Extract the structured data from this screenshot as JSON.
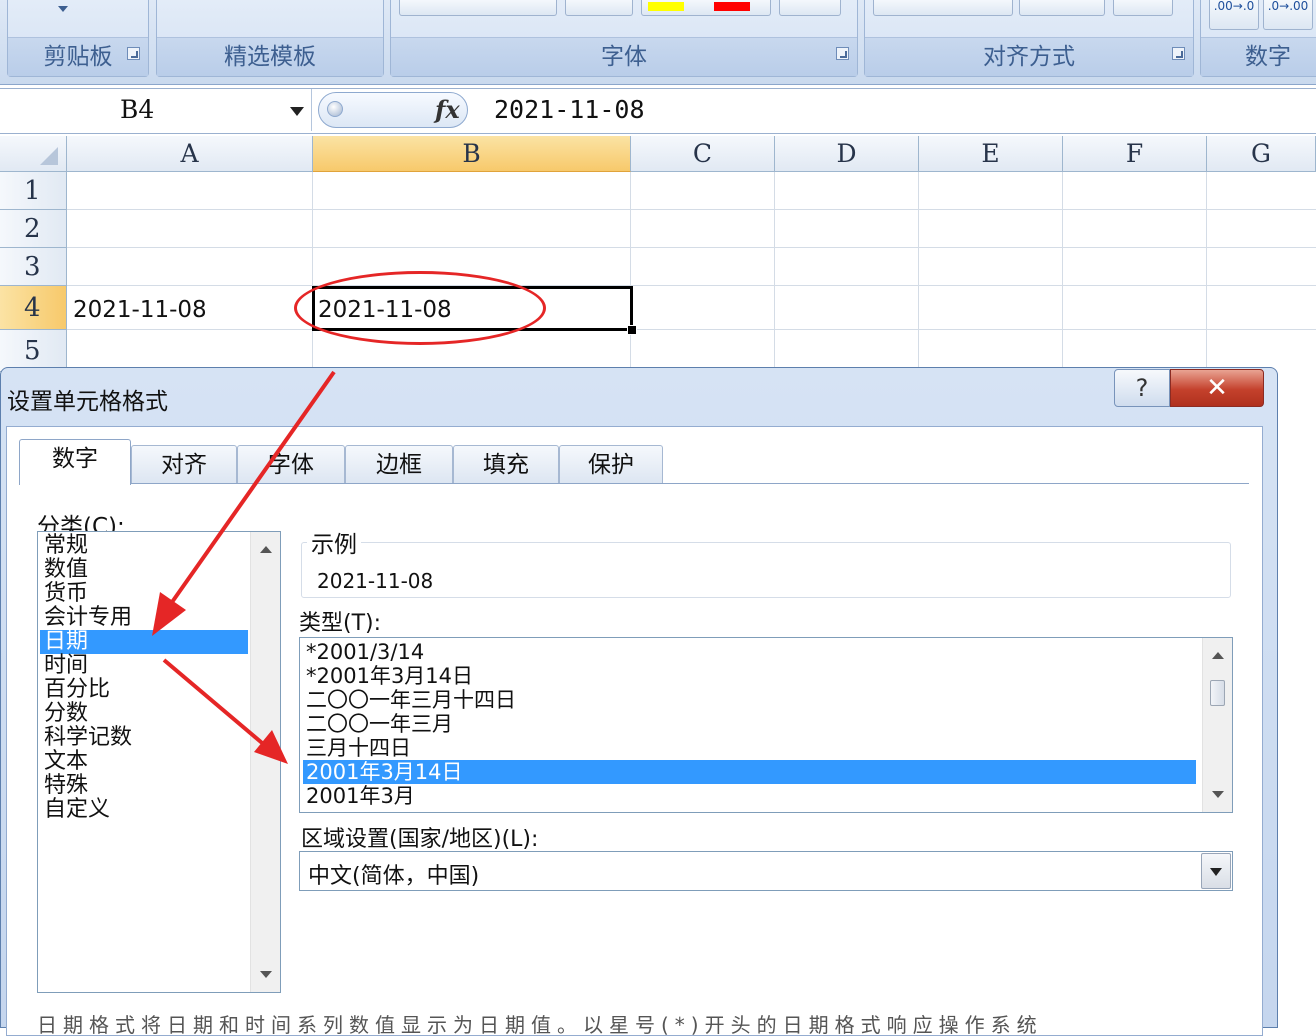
{
  "ribbon": {
    "groups": [
      "剪贴板",
      "精选模板",
      "字体",
      "对齐方式",
      "数字"
    ],
    "number_format_icons": [
      ".00→.0",
      ".0→.00"
    ]
  },
  "formula_bar": {
    "name_box": "B4",
    "fx_icon": "fx",
    "content": "2021-11-08"
  },
  "sheet": {
    "columns": [
      "A",
      "B",
      "C",
      "D",
      "E",
      "F",
      "G"
    ],
    "rows": [
      "1",
      "2",
      "3",
      "4",
      "5"
    ],
    "cells": {
      "A4": "2021-11-08",
      "B4": "2021-11-08"
    },
    "selected_cell": "B4"
  },
  "dialog": {
    "title": "设置单元格格式",
    "help_label": "?",
    "close_label": "✕",
    "tabs": [
      "数字",
      "对齐",
      "字体",
      "边框",
      "填充",
      "保护"
    ],
    "active_tab": "数字",
    "category_label": "分类(C):",
    "categories": [
      "常规",
      "数值",
      "货币",
      "会计专用",
      "日期",
      "时间",
      "百分比",
      "分数",
      "科学记数",
      "文本",
      "特殊",
      "自定义"
    ],
    "selected_category": "日期",
    "sample_label": "示例",
    "sample_value": "2021-11-08",
    "type_label": "类型(T):",
    "types": [
      "*2001/3/14",
      "*2001年3月14日",
      "二〇〇一年三月十四日",
      "二〇〇一年三月",
      "三月十四日",
      "2001年3月14日",
      "2001年3月"
    ],
    "selected_type": "2001年3月14日",
    "locale_label": "区域设置(国家/地区)(L):",
    "locale_value": "中文(简体，中国)",
    "description_partial": "日期格式将日期和时间系列数值显示为日期值。以星号(*)开头的日期格式响应操作系统"
  },
  "colors": {
    "selection_blue": "#3399ff",
    "annotation_red": "#e52626",
    "header_highlight": "#f7c96b",
    "close_button_red": "#c4412c"
  },
  "annotations": {
    "circle_target": "B4",
    "arrow_targets": [
      "日期",
      "2001年3月14日"
    ]
  }
}
